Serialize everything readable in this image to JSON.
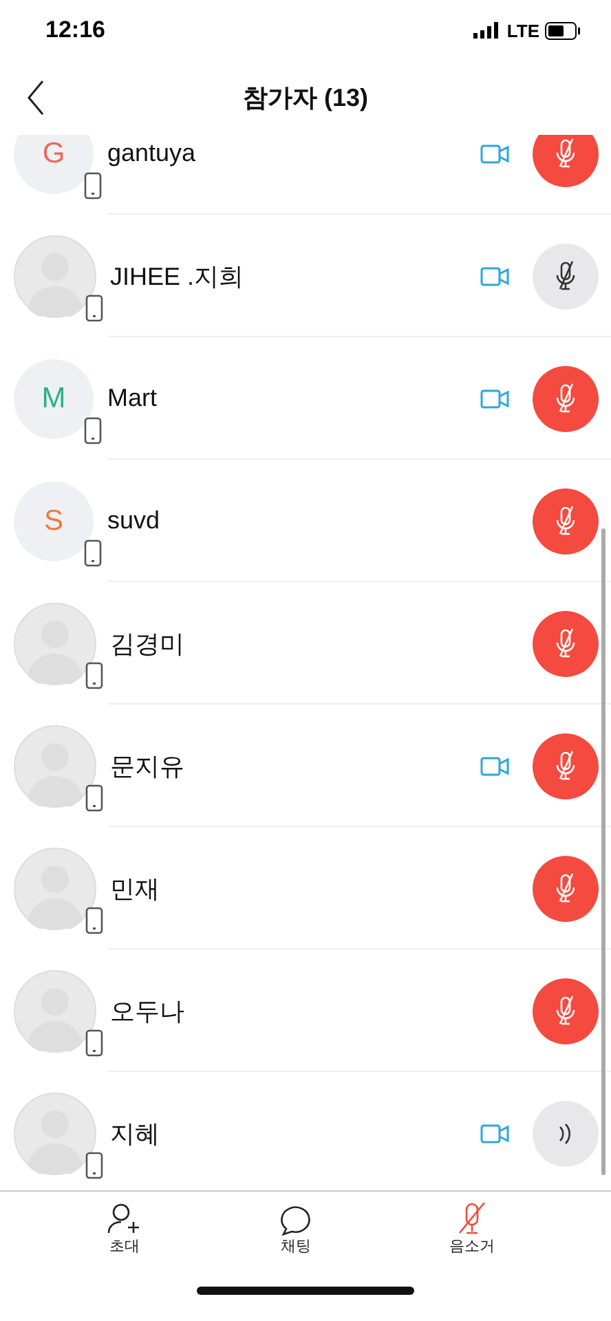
{
  "status_bar": {
    "time": "12:16",
    "network": "LTE"
  },
  "header": {
    "title": "참가자 (13)"
  },
  "participants": [
    {
      "name": "gantuya",
      "avatar": {
        "kind": "initial",
        "initial": "G",
        "color": "#f0665a"
      },
      "video": true,
      "muted": true,
      "highlighted": true
    },
    {
      "name": "JIHEE .지희",
      "avatar": {
        "kind": "silhouette"
      },
      "video": true,
      "muted": true,
      "highlighted": false
    },
    {
      "name": "Mart",
      "avatar": {
        "kind": "initial",
        "initial": "M",
        "color": "#2fae8a"
      },
      "video": true,
      "muted": true,
      "highlighted": true
    },
    {
      "name": "suvd",
      "avatar": {
        "kind": "initial",
        "initial": "S",
        "color": "#f07a3a"
      },
      "video": false,
      "muted": true,
      "highlighted": true
    },
    {
      "name": "김경미",
      "avatar": {
        "kind": "silhouette"
      },
      "video": false,
      "muted": true,
      "highlighted": true
    },
    {
      "name": "문지유",
      "avatar": {
        "kind": "silhouette"
      },
      "video": true,
      "muted": true,
      "highlighted": true
    },
    {
      "name": "민재",
      "avatar": {
        "kind": "silhouette"
      },
      "video": false,
      "muted": true,
      "highlighted": true
    },
    {
      "name": "오두나",
      "avatar": {
        "kind": "silhouette"
      },
      "video": false,
      "muted": true,
      "highlighted": true
    },
    {
      "name": "지혜",
      "avatar": {
        "kind": "silhouette"
      },
      "video": true,
      "muted": false,
      "highlighted": false
    }
  ],
  "tab_bar": [
    {
      "kind": "invite",
      "label": "초대"
    },
    {
      "kind": "chat",
      "label": "채팅"
    },
    {
      "kind": "mute",
      "label": "음소거"
    }
  ]
}
